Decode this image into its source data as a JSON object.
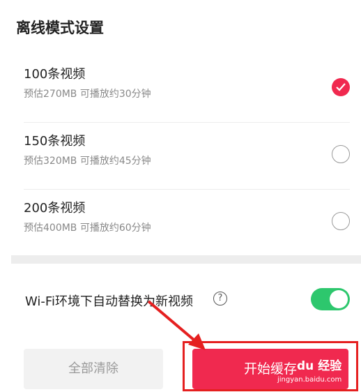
{
  "page": {
    "title": "离线模式设置"
  },
  "options": [
    {
      "label": "100条视频",
      "description": "预估270MB 可播放约30分钟",
      "selected": true
    },
    {
      "label": "150条视频",
      "description": "预估320MB 可播放约45分钟",
      "selected": false
    },
    {
      "label": "200条视频",
      "description": "预估400MB 可播放约60分钟",
      "selected": false
    }
  ],
  "wifi_setting": {
    "label": "Wi-Fi环境下自动替换为新视频",
    "help_glyph": "?",
    "enabled": true
  },
  "actions": {
    "clear_label": "全部清除",
    "start_label": "开始缓存"
  },
  "watermark": {
    "logo_text": "du 经验",
    "url_text": "jingyan.baidu.com"
  },
  "colors": {
    "accent": "#f0294f",
    "toggle_on": "#2dc76d",
    "annotation": "#e52020"
  }
}
